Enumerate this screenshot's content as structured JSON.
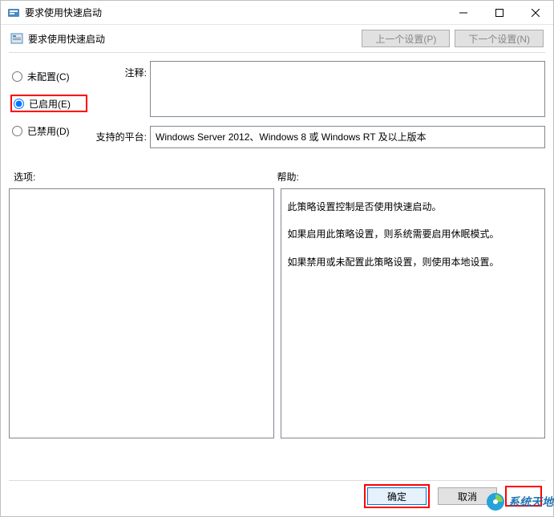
{
  "window": {
    "title": "要求使用快速启动"
  },
  "header": {
    "policy_title": "要求使用快速启动",
    "prev_button": "上一个设置(P)",
    "next_button": "下一个设置(N)"
  },
  "radios": {
    "not_configured": "未配置(C)",
    "enabled": "已启用(E)",
    "disabled": "已禁用(D)",
    "selected": "enabled"
  },
  "labels": {
    "comment": "注释:",
    "platform": "支持的平台:",
    "options": "选项:",
    "help": "帮助:"
  },
  "fields": {
    "comment_value": "",
    "platform_value": "Windows Server 2012、Windows 8 或 Windows RT 及以上版本"
  },
  "help": {
    "p1": "此策略设置控制是否使用快速启动。",
    "p2": "如果启用此策略设置，则系统需要启用休眠模式。",
    "p3": "如果禁用或未配置此策略设置，则使用本地设置。"
  },
  "footer": {
    "ok": "确定",
    "cancel": "取消"
  },
  "watermark": {
    "text": "系统天地"
  }
}
